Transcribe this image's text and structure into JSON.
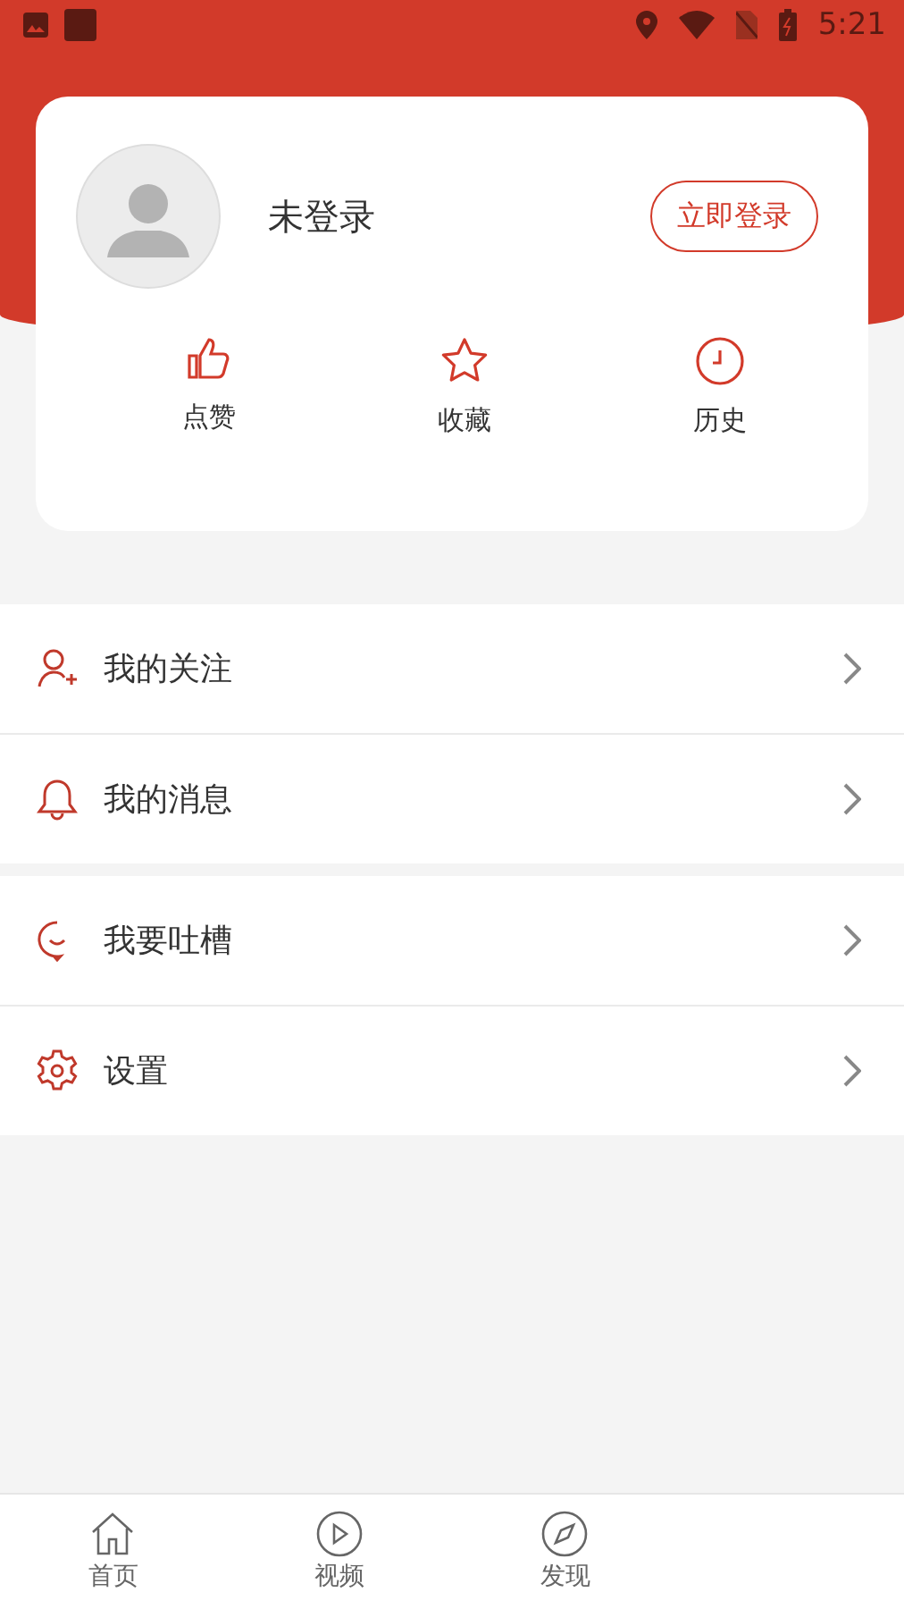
{
  "status_bar": {
    "time": "5:21"
  },
  "profile": {
    "name": "未登录",
    "login_button": "立即登录"
  },
  "shortcuts": [
    {
      "kind": "like",
      "label": "点赞"
    },
    {
      "kind": "star",
      "label": "收藏"
    },
    {
      "kind": "clock",
      "label": "历史"
    }
  ],
  "menu_groups": [
    [
      {
        "kind": "follow",
        "label": "我的关注"
      },
      {
        "kind": "bell",
        "label": "我的消息"
      }
    ],
    [
      {
        "kind": "chat",
        "label": "我要吐槽"
      },
      {
        "kind": "gear",
        "label": "设置"
      }
    ]
  ],
  "tab_bar": [
    {
      "kind": "home",
      "label": "首页",
      "selected": false
    },
    {
      "kind": "play",
      "label": "视频",
      "selected": false
    },
    {
      "kind": "compass",
      "label": "发现",
      "selected": false
    }
  ]
}
